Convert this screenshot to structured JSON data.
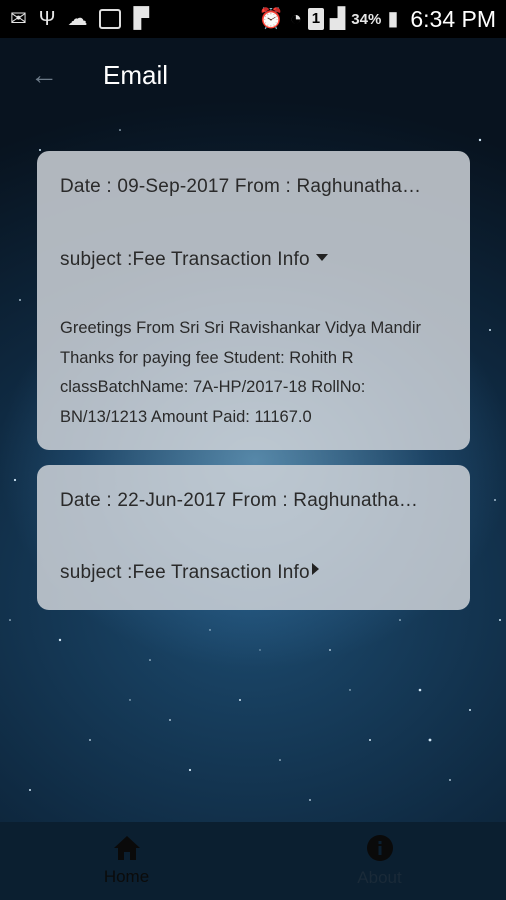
{
  "statusbar": {
    "battery": "34%",
    "time": "6:34 PM",
    "sim_slot": "1",
    "icons": [
      "mail-icon",
      "usb-icon",
      "cloud-icon",
      "image-icon",
      "flipboard-icon",
      "alarm-icon",
      "wifi-icon",
      "signal-icon",
      "battery-icon"
    ]
  },
  "appbar": {
    "title": "Email"
  },
  "emails": [
    {
      "date_from": "Date : 09-Sep-2017 From : Raghunatha…",
      "subject": "subject :Fee Transaction Info",
      "body": "Greetings From Sri Sri Ravishankar Vidya Mandir Thanks for paying fee Student: Rohith R classBatchName: 7A-HP/2017-18 RollNo: BN/13/1213 Amount Paid: 11167.0",
      "expanded": true
    },
    {
      "date_from": "Date : 22-Jun-2017 From : Raghunatha…",
      "subject": "subject :Fee Transaction Info",
      "expanded": false
    }
  ],
  "bottomnav": {
    "home_label": "Home",
    "about_label": "About"
  }
}
